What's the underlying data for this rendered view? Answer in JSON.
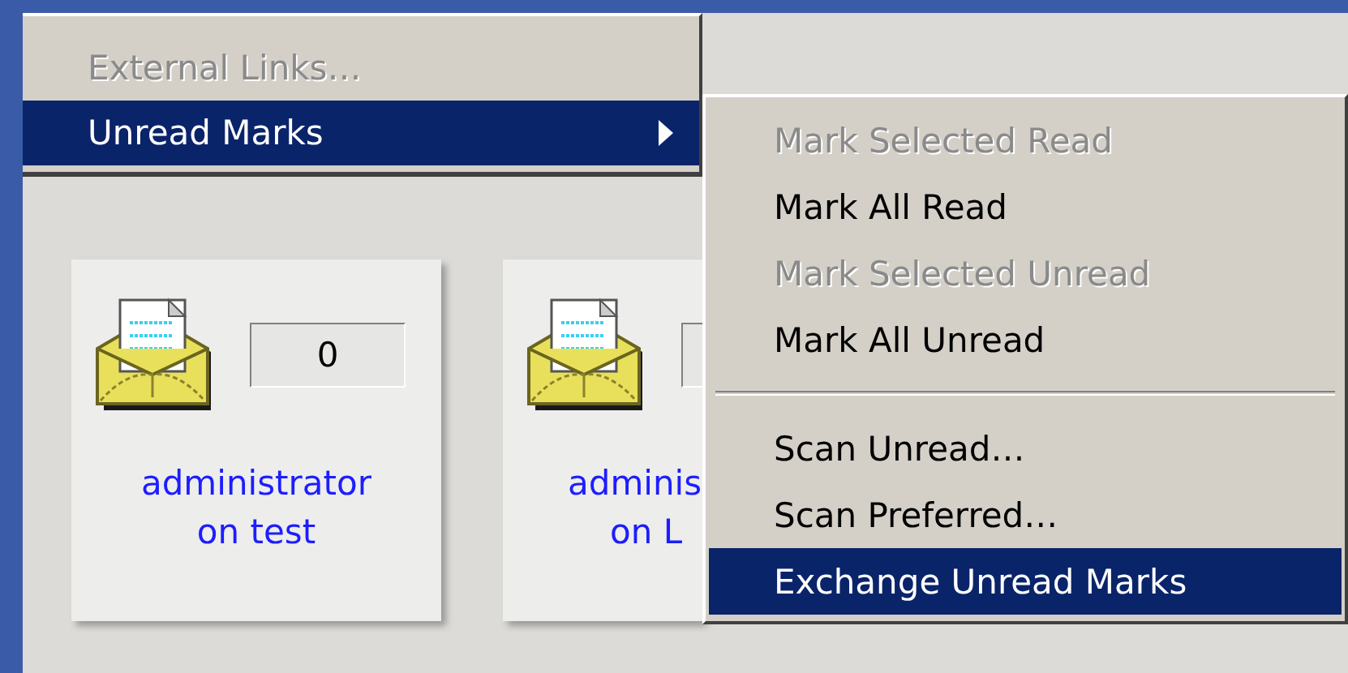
{
  "menu": {
    "items": [
      {
        "label": "External Links…",
        "disabled": true,
        "selected": false,
        "has_submenu": false
      },
      {
        "label": "Unread Marks",
        "disabled": false,
        "selected": true,
        "has_submenu": true
      }
    ]
  },
  "submenu": {
    "items": [
      {
        "kind": "item",
        "label": "Mark Selected Read",
        "disabled": true,
        "selected": false
      },
      {
        "kind": "item",
        "label": "Mark All Read",
        "disabled": false,
        "selected": false
      },
      {
        "kind": "item",
        "label": "Mark Selected Unread",
        "disabled": true,
        "selected": false
      },
      {
        "kind": "item",
        "label": "Mark All Unread",
        "disabled": false,
        "selected": false
      },
      {
        "kind": "separator"
      },
      {
        "kind": "item",
        "label": "Scan Unread…",
        "disabled": false,
        "selected": false
      },
      {
        "kind": "item",
        "label": "Scan Preferred…",
        "disabled": false,
        "selected": false
      },
      {
        "kind": "item",
        "label": "Exchange Unread Marks",
        "disabled": false,
        "selected": true
      }
    ]
  },
  "cards": [
    {
      "count": "0",
      "lines": [
        "administrator",
        "on test"
      ]
    },
    {
      "lines": [
        "adminis",
        "on L"
      ]
    }
  ]
}
